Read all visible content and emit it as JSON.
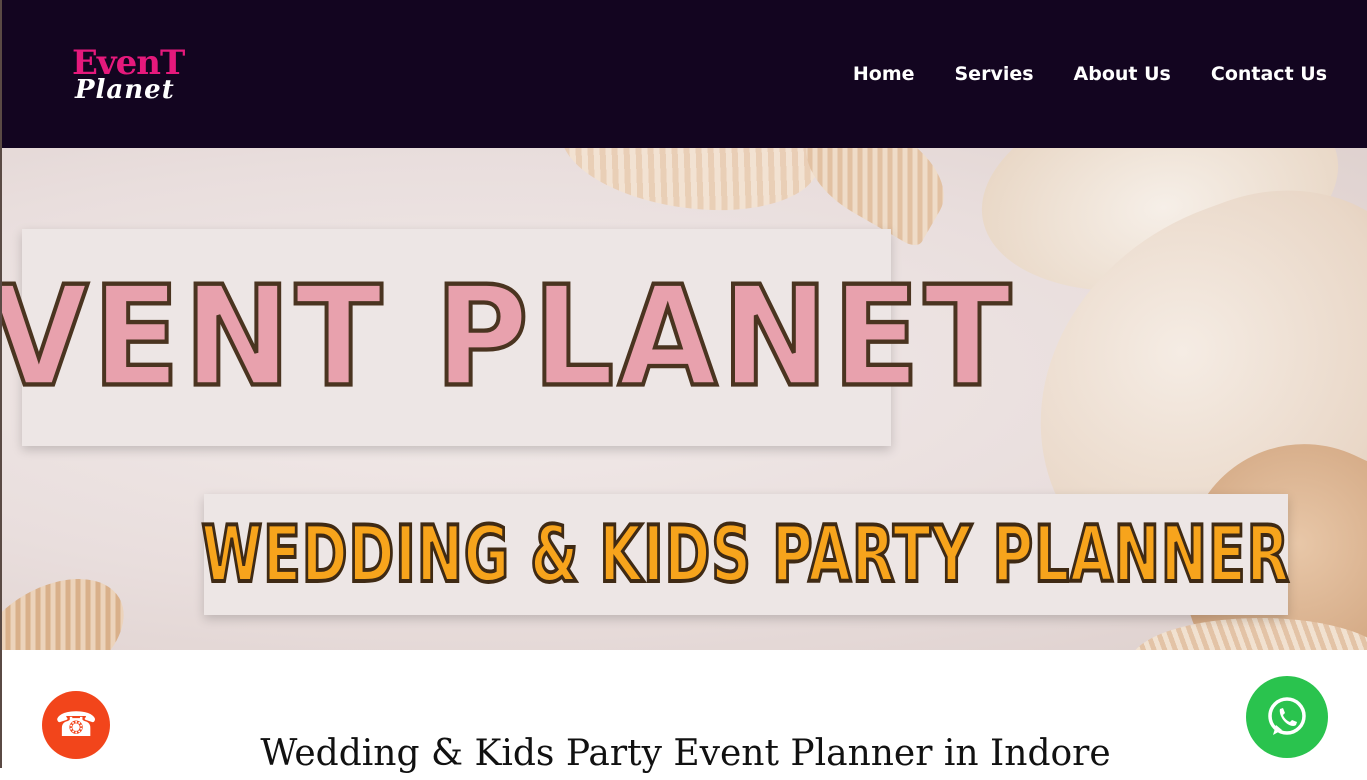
{
  "header": {
    "logo": {
      "line1": "EvenT",
      "line2": "Planet"
    },
    "nav": [
      {
        "label": "Home"
      },
      {
        "label": "Servies"
      },
      {
        "label": "About Us"
      },
      {
        "label": "Contact Us"
      }
    ],
    "background": "#130520",
    "brand_pink": "#e6197c"
  },
  "hero": {
    "title": "EVENT PLANET",
    "subtitle": "WEDDING & KIDS PARTY PLANNER",
    "title_color": "#e8a1ad",
    "subtitle_color": "#f7a41c"
  },
  "content": {
    "heading": "Wedding & Kids Party Event Planner in Indore"
  },
  "floating": {
    "call": {
      "icon": "phone-icon",
      "glyph": "☎",
      "color": "#f2451b"
    },
    "whatsapp": {
      "icon": "whatsapp-icon",
      "color": "#2ac34e"
    }
  }
}
